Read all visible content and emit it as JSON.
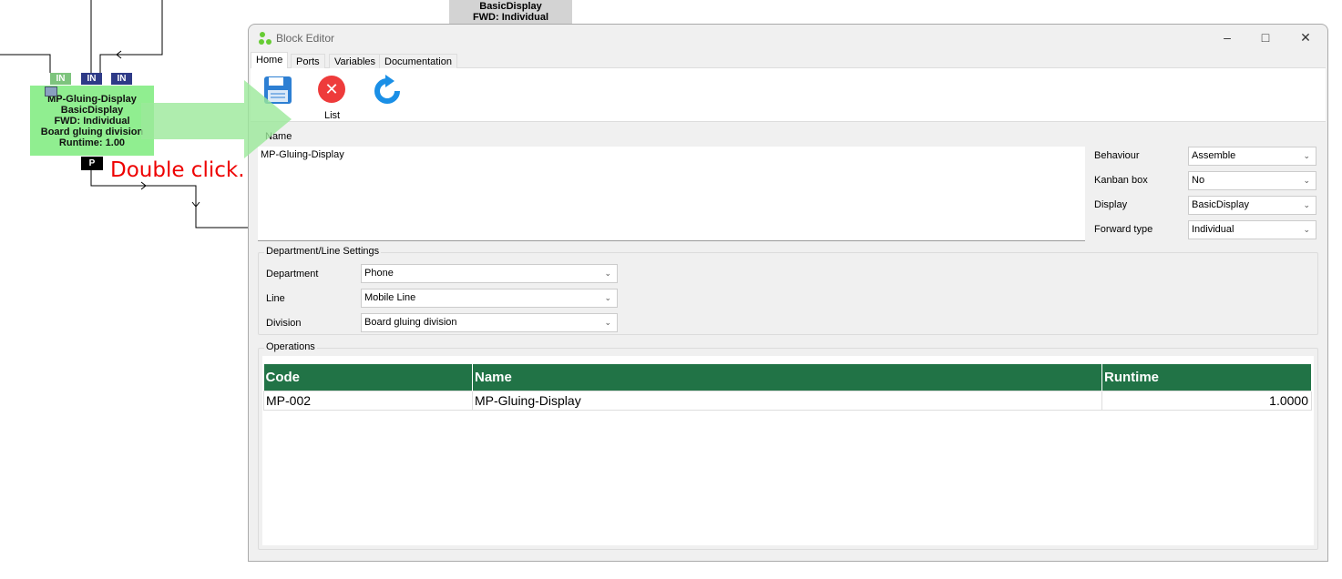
{
  "canvas": {
    "block": {
      "lines": [
        "MP-Gluing-Display",
        "BasicDisplay",
        "FWD: Individual",
        "Board gluing division",
        "Runtime: 1.00"
      ]
    },
    "ports_in": [
      {
        "label": "IN",
        "color": "#7dc47d"
      },
      {
        "label": "IN",
        "color": "#2e3a87"
      },
      {
        "label": "IN",
        "color": "#2e3a87"
      }
    ],
    "port_out": {
      "label": "P"
    },
    "other_block": {
      "lines": [
        "BasicDisplay",
        "FWD: Individual"
      ]
    },
    "hint": "Double click."
  },
  "window": {
    "title": "Block Editor",
    "tabs": [
      "Home",
      "Ports",
      "Variables",
      "Documentation"
    ],
    "toolbar": {
      "save_icon": "floppy-disk",
      "list_label": "List",
      "refresh_icon": "refresh"
    },
    "name_group": {
      "label": "Name",
      "value": "MP-Gluing-Display"
    },
    "props": [
      {
        "label": "Behaviour",
        "value": "Assemble"
      },
      {
        "label": "Kanban box",
        "value": "No"
      },
      {
        "label": "Display",
        "value": "BasicDisplay"
      },
      {
        "label": "Forward type",
        "value": "Individual"
      }
    ],
    "dept": {
      "label": "Department/Line Settings",
      "fields": [
        {
          "label": "Department",
          "value": "Phone"
        },
        {
          "label": "Line",
          "value": "Mobile Line"
        },
        {
          "label": "Division",
          "value": "Board gluing division"
        }
      ]
    },
    "operations": {
      "label": "Operations",
      "columns": [
        "Code",
        "Name",
        "Runtime"
      ],
      "rows": [
        [
          "MP-002",
          "MP-Gluing-Display",
          "1.0000"
        ]
      ]
    }
  }
}
